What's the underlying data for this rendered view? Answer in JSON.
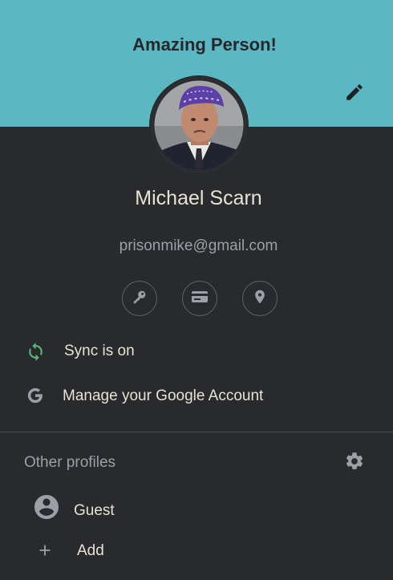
{
  "banner": {
    "title": "Amazing Person!",
    "color": "#5bb8c2",
    "edit_icon": "pencil-icon"
  },
  "profile": {
    "name": "Michael Scarn",
    "email": "prisonmike@gmail.com",
    "avatar": "avatar-photo"
  },
  "quick_actions": [
    {
      "icon": "key-icon"
    },
    {
      "icon": "credit-card-icon"
    },
    {
      "icon": "location-pin-icon"
    }
  ],
  "sync": {
    "label": "Sync is on",
    "icon": "sync-icon",
    "color": "#5bb974"
  },
  "manage_account": {
    "label": "Manage your Google Account",
    "icon": "google-g-icon"
  },
  "other_profiles": {
    "title": "Other profiles",
    "settings_icon": "gear-icon",
    "items": [
      {
        "label": "Guest",
        "icon": "account-circle-icon"
      },
      {
        "label": "Add",
        "icon": "plus-icon"
      }
    ]
  }
}
